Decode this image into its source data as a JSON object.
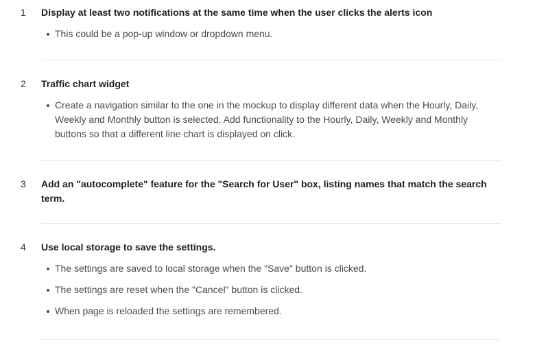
{
  "items": [
    {
      "number": "1",
      "title": "Display at least two notifications at the same time when the user clicks the alerts icon",
      "bullets": [
        "This could be a pop-up window or dropdown menu."
      ]
    },
    {
      "number": "2",
      "title": "Traffic chart widget",
      "bullets": [
        "Create a navigation similar to the one in the mockup to display different data when the Hourly, Daily, Weekly and Monthly button is selected. Add functionality to the Hourly, Daily, Weekly and Monthly buttons so that a different line chart is displayed on click."
      ]
    },
    {
      "number": "3",
      "title": "Add an \"autocomplete\" feature for the \"Search for User\" box, listing names that match the search term.",
      "bullets": []
    },
    {
      "number": "4",
      "title": "Use local storage to save the settings.",
      "bullets": [
        "The settings are saved to local storage when the \"Save\" button is clicked.",
        "The settings are reset when the \"Cancel\" button is clicked.",
        "When page is reloaded the settings are remembered."
      ]
    }
  ],
  "colors": {
    "text_primary": "#1f1f1f",
    "text_secondary": "#4a4a4a",
    "divider": "#e6e6e6",
    "background": "#ffffff"
  }
}
